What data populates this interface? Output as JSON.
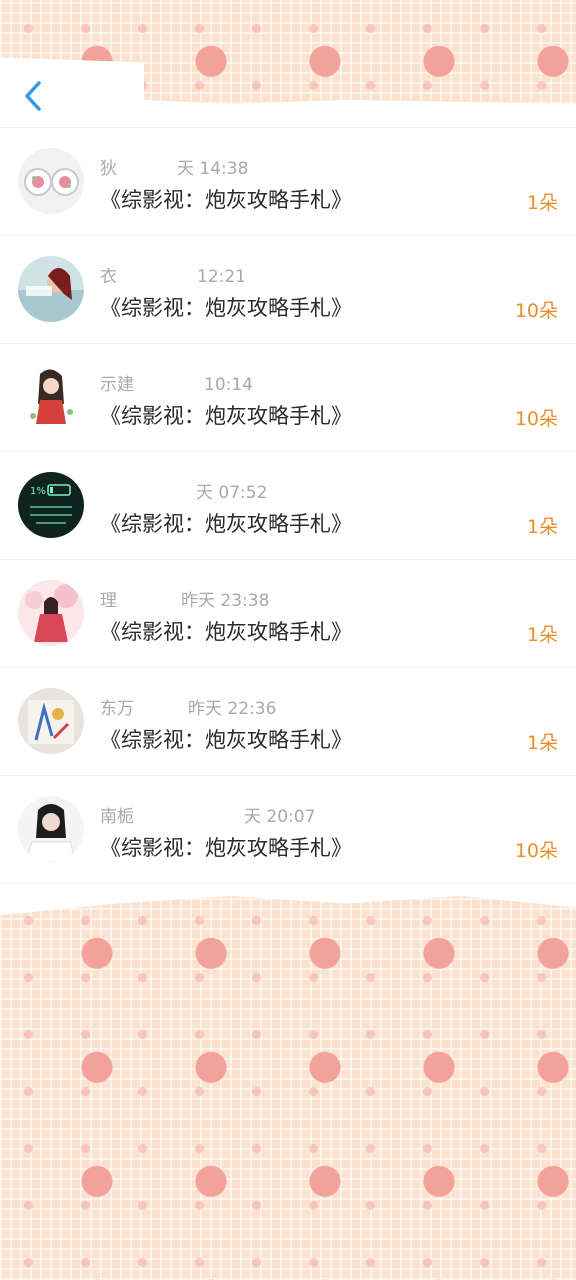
{
  "header": {
    "back_icon": "chevron-left-icon",
    "accent_color": "#2e9bf0"
  },
  "gift_color": "#e88f2c",
  "rows": [
    {
      "name": "狄",
      "time": "天 14:38",
      "title": "《综影视：炮灰攻略手札》",
      "gift": "1朵",
      "avatar": "embroidered-flower-earrings"
    },
    {
      "name": "衣",
      "time": "12:21",
      "title": "《综影视：炮灰攻略手札》",
      "gift": "10朵",
      "avatar": "girl-photo"
    },
    {
      "name": "示建",
      "time": "10:14",
      "title": "《综影视：炮灰攻略手札》",
      "gift": "10朵",
      "avatar": "cartoon-girl"
    },
    {
      "name": "",
      "time": "天 07:52",
      "title": "《综影视：炮灰攻略手札》",
      "gift": "1朵",
      "avatar": "battery-1-percent-phone-screen"
    },
    {
      "name": "理",
      "time": "昨天 23:38",
      "title": "《综影视：炮灰攻略手札》",
      "gift": "1朵",
      "avatar": "anime-girl-pink"
    },
    {
      "name": "东万",
      "time": "昨天 22:36",
      "title": "《综影视：炮灰攻略手札》",
      "gift": "1朵",
      "avatar": "colorful-drawing"
    },
    {
      "name": "南栀",
      "time": "天 20:07",
      "title": "《综影视：炮灰攻略手札》",
      "gift": "10朵",
      "avatar": "woman-photo"
    }
  ]
}
